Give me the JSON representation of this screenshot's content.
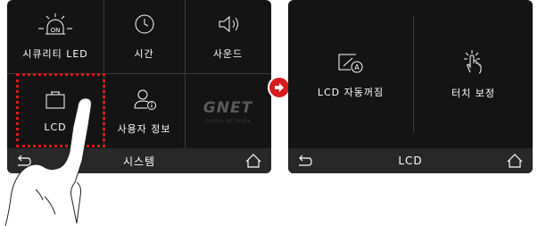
{
  "left_screen": {
    "menu_items": [
      {
        "label": "시큐리티 LED",
        "badge": "ON",
        "icon": "security-led-icon"
      },
      {
        "label": "시간",
        "icon": "clock-icon"
      },
      {
        "label": "사운드",
        "icon": "speaker-icon"
      },
      {
        "label": "LCD",
        "icon": "lcd-icon"
      },
      {
        "label": "사용자 정보",
        "icon": "user-info-icon"
      }
    ],
    "logo_text": "GNET",
    "logo_subtext": "GLOBAL NETWORK",
    "title": "시스템"
  },
  "right_screen": {
    "menu_items": [
      {
        "label": "LCD 자동꺼짐",
        "icon": "lcd-auto-off-icon"
      },
      {
        "label": "터치 보정",
        "icon": "touch-calibration-icon"
      }
    ],
    "title": "LCD"
  },
  "navigation": {
    "back_icon": "back-arrow-icon",
    "home_icon": "home-icon"
  },
  "transition_icon": "next-arrow-icon",
  "colors": {
    "screen_bg": "#141414",
    "bar_bg": "#282828",
    "highlight": "#e01818",
    "arrow_badge": "#d81b1b"
  }
}
